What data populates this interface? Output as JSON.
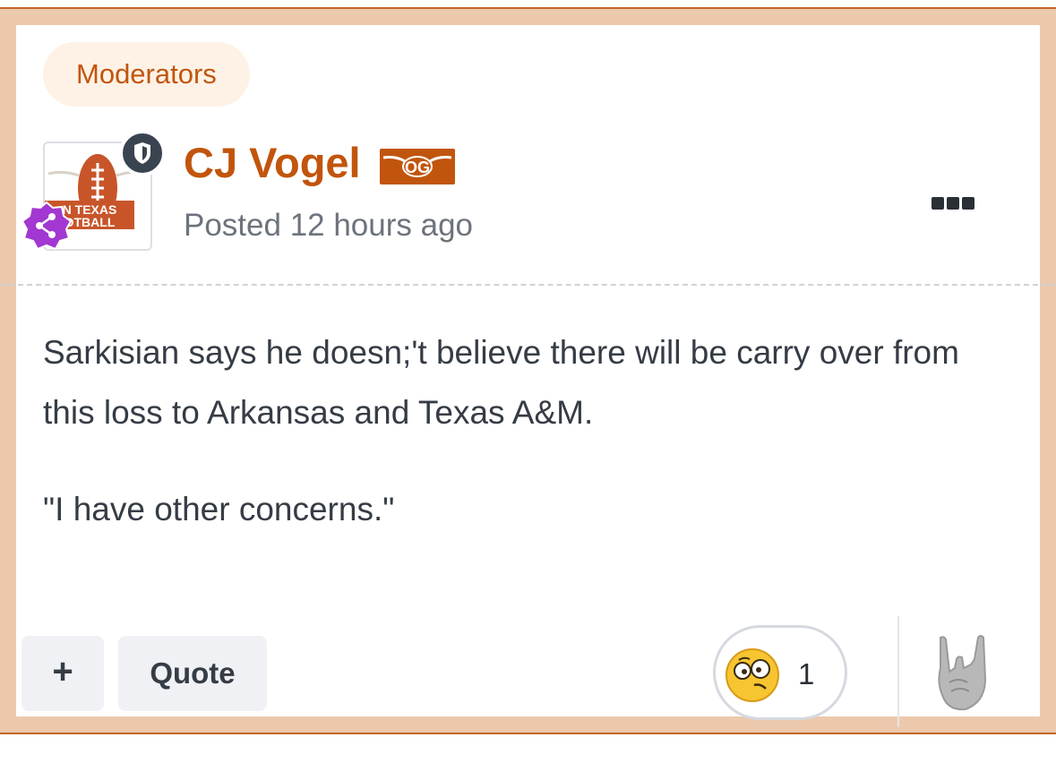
{
  "post": {
    "group_badge": "Moderators",
    "author": "CJ Vogel",
    "posted": "Posted 12 hours ago",
    "avatar_text": {
      "line1": "N TEXAS",
      "line2": "OTBALL"
    },
    "rank_badge_text": "OG",
    "body": [
      "Sarkisian says he doesn;'t believe there will be carry over from this loss to Arkansas and Texas A&M.",
      "\"I have other concerns.\""
    ]
  },
  "actions": {
    "add_label": "+",
    "quote_label": "Quote",
    "reaction_count": "1",
    "reaction_icon": "confused-face-icon",
    "react_icon": "hook-em-horns-icon",
    "menu_icon": "more-options-icon"
  },
  "colors": {
    "accent": "#c1550d",
    "frame": "#ecc9ad",
    "frame_border": "#c1662a",
    "badge_bg": "#fdf2e5",
    "share_badge": "#a238d1",
    "mod_badge": "#3a4350"
  }
}
